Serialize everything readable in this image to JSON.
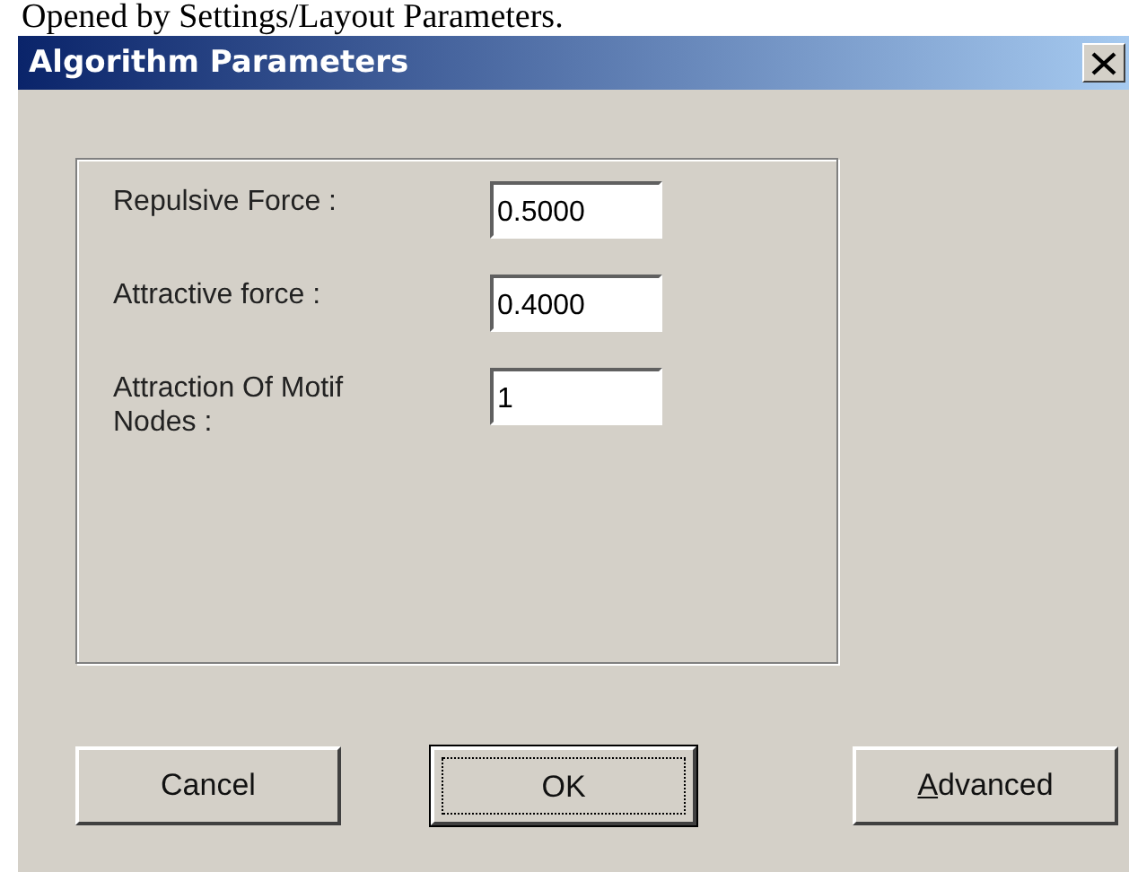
{
  "caption": "Opened by Settings/Layout Parameters.",
  "window": {
    "title": "Algorithm Parameters"
  },
  "fields": [
    {
      "label": "Repulsive Force :",
      "value": "0.5000"
    },
    {
      "label": "Attractive force  :",
      "value": "0.4000"
    },
    {
      "label": "Attraction Of Motif Nodes :",
      "value": "1"
    }
  ],
  "buttons": [
    {
      "label": "Cancel",
      "default": false
    },
    {
      "label": "OK",
      "default": true
    },
    {
      "label": "Advanced",
      "default": false,
      "first_letter_underlined": true
    }
  ]
}
